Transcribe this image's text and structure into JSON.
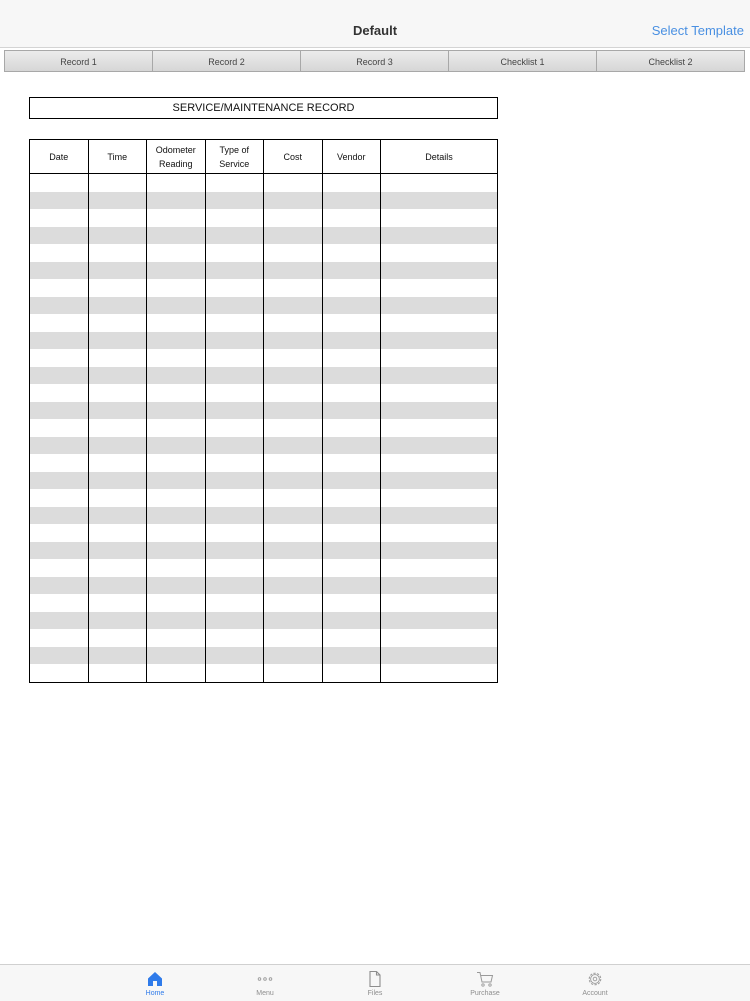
{
  "navbar": {
    "title": "Default",
    "action": "Select Template"
  },
  "tabs": [
    {
      "label": "Record 1"
    },
    {
      "label": "Record 2"
    },
    {
      "label": "Record 3"
    },
    {
      "label": "Checklist 1"
    },
    {
      "label": "Checklist 2"
    }
  ],
  "document": {
    "title": "SERVICE/MAINTENANCE RECORD",
    "columns": [
      "Date",
      "Time",
      "Odometer\nReading",
      "Type of\nService",
      "Cost",
      "Vendor",
      "Details"
    ],
    "row_count": 29
  },
  "bottom_bar": {
    "items": [
      {
        "label": "Home",
        "icon": "home-icon",
        "active": true
      },
      {
        "label": "Menu",
        "icon": "more-dots-icon",
        "active": false
      },
      {
        "label": "Files",
        "icon": "file-icon",
        "active": false
      },
      {
        "label": "Purchase",
        "icon": "cart-icon",
        "active": false
      },
      {
        "label": "Account",
        "icon": "gear-icon",
        "active": false
      }
    ]
  },
  "colors": {
    "accent": "#4a90e2",
    "active_tab_icon": "#2f7bea",
    "row_stripe": "#dcdcdc"
  }
}
